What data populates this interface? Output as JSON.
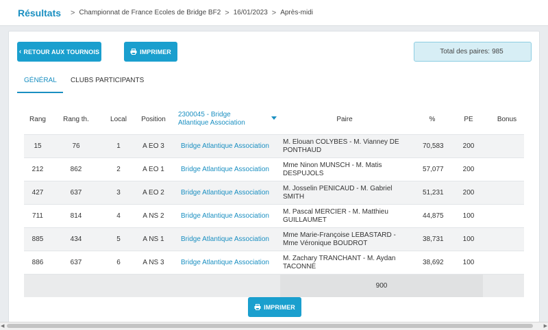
{
  "breadcrumb": {
    "main": "Résultats",
    "items": [
      "Championnat de France Ecoles de Bridge BF2",
      "16/01/2023",
      "Après-midi"
    ]
  },
  "toolbar": {
    "back_label": "RETOUR AUX TOURNOIS",
    "print_label": "IMPRIMER",
    "total_label": "Total des paires:",
    "total_value": "985"
  },
  "tabs": [
    {
      "label": "GÉNÉRAL"
    },
    {
      "label": "CLUBS PARTICIPANTS"
    }
  ],
  "table": {
    "headers": {
      "rang": "Rang",
      "rang_th": "Rang th.",
      "local": "Local",
      "position": "Position",
      "club": "2300045 - Bridge Atlantique Association",
      "paire": "Paire",
      "pct": "%",
      "pe": "PE",
      "bonus": "Bonus"
    },
    "rows": [
      {
        "rang": "15",
        "rang_th": "76",
        "local": "1",
        "position": "A EO 3",
        "club": "Bridge Atlantique Association",
        "paire": "M. Elouan COLYBES - M. Vianney DE PONTHAUD",
        "pct": "70,583",
        "pe": "200",
        "bonus": ""
      },
      {
        "rang": "212",
        "rang_th": "862",
        "local": "2",
        "position": "A EO 1",
        "club": "Bridge Atlantique Association",
        "paire": "Mme Ninon MUNSCH - M. Matis DESPUJOLS",
        "pct": "57,077",
        "pe": "200",
        "bonus": ""
      },
      {
        "rang": "427",
        "rang_th": "637",
        "local": "3",
        "position": "A EO 2",
        "club": "Bridge Atlantique Association",
        "paire": "M. Josselin PENICAUD - M. Gabriel SMITH",
        "pct": "51,231",
        "pe": "200",
        "bonus": ""
      },
      {
        "rang": "711",
        "rang_th": "814",
        "local": "4",
        "position": "A NS 2",
        "club": "Bridge Atlantique Association",
        "paire": "M. Pascal MERCIER - M. Matthieu GUILLAUMET",
        "pct": "44,875",
        "pe": "100",
        "bonus": ""
      },
      {
        "rang": "885",
        "rang_th": "434",
        "local": "5",
        "position": "A NS 1",
        "club": "Bridge Atlantique Association",
        "paire": "Mme Marie-Françoise LEBASTARD - Mme Véronique BOUDROT",
        "pct": "38,731",
        "pe": "100",
        "bonus": ""
      },
      {
        "rang": "886",
        "rang_th": "637",
        "local": "6",
        "position": "A NS 3",
        "club": "Bridge Atlantique Association",
        "paire": "M. Zachary TRANCHANT - M. Aydan TACONNÉ",
        "pct": "38,692",
        "pe": "100",
        "bonus": ""
      }
    ],
    "footer_total": "900"
  },
  "bottom": {
    "print_label": "IMPRIMER"
  },
  "colors": {
    "accent": "#1a9fce",
    "link": "#1a8fc1",
    "total_bg": "#d7eef5"
  }
}
